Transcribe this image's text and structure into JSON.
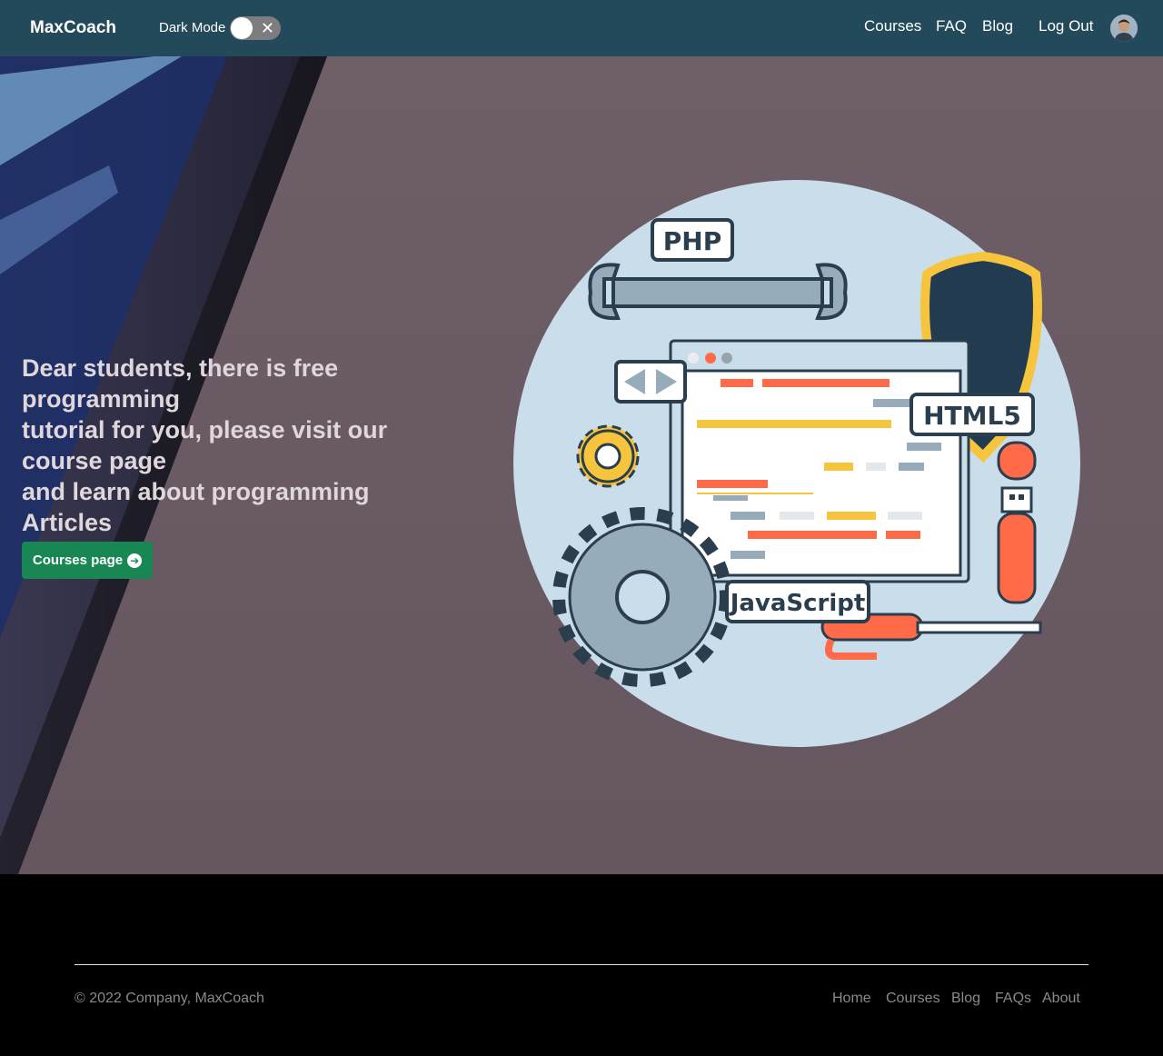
{
  "navbar": {
    "brand": "MaxCoach",
    "dark_mode_label": "Dark Mode",
    "links": {
      "courses": "Courses",
      "faq": "FAQ",
      "blog": "Blog",
      "logout": "Log Out"
    }
  },
  "hero": {
    "lines": [
      "Dear students, there is free programming",
      "tutorial for you, please visit our course page",
      "and learn about programming Articles"
    ],
    "cta_label": "Courses page",
    "illustration_tags": {
      "php": "PHP",
      "html5": "HTML5",
      "javascript": "JavaScript"
    }
  },
  "footer": {
    "copyright": "© 2022 Company, MaxCoach",
    "links": {
      "home": "Home",
      "courses": "Courses",
      "blog": "Blog",
      "faqs": "FAQs",
      "about": "About"
    }
  },
  "colors": {
    "navbar_bg": "#234a5a",
    "cta_bg": "#198754",
    "hero_bg": "#6a5a64",
    "footer_bg": "#000000"
  }
}
